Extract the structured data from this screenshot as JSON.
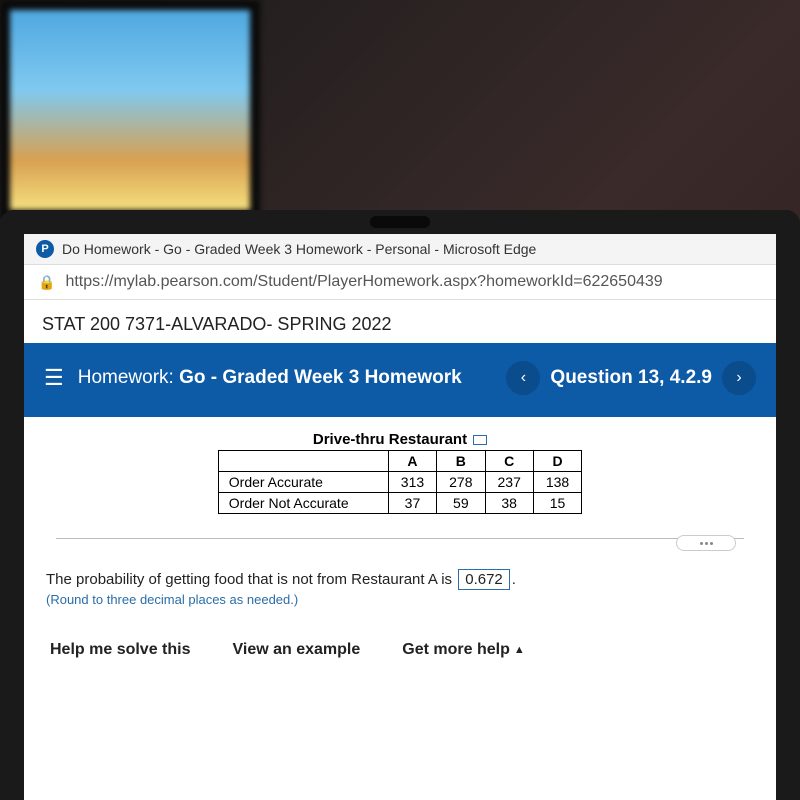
{
  "app_icon_letter": "P",
  "window_title": "Do Homework - Go - Graded Week 3 Homework - Personal - Microsoft Edge",
  "url": "https://mylab.pearson.com/Student/PlayerHomework.aspx?homeworkId=622650439",
  "course_name": "STAT 200 7371-ALVARADO- SPRING 2022",
  "homework": {
    "prefix": "Homework:",
    "title": "Go - Graded Week 3 Homework"
  },
  "question_label": "Question 13, 4.2.9",
  "table": {
    "title": "Drive-thru Restaurant",
    "cols": [
      "A",
      "B",
      "C",
      "D"
    ],
    "rows": [
      {
        "label": "Order Accurate",
        "vals": [
          "313",
          "278",
          "237",
          "138"
        ]
      },
      {
        "label": "Order Not Accurate",
        "vals": [
          "37",
          "59",
          "38",
          "15"
        ]
      }
    ]
  },
  "answer": {
    "text_before": "The probability of getting food that is not from Restaurant A is",
    "value": "0.672",
    "text_after": ".",
    "note": "(Round to three decimal places as needed.)"
  },
  "bottom": {
    "help": "Help me solve this",
    "example": "View an example",
    "more": "Get more help"
  },
  "nav": {
    "prev": "‹",
    "next": "›"
  }
}
